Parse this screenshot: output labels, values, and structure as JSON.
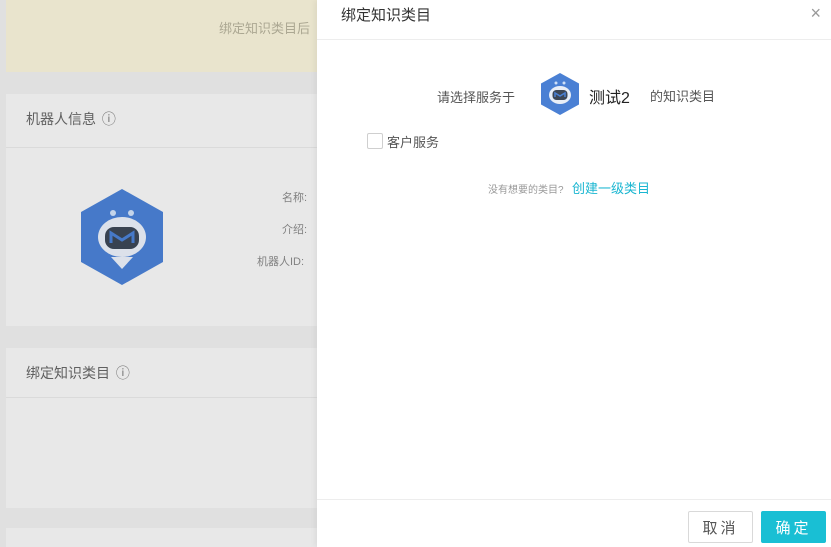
{
  "background": {
    "notice_text": "绑定知识类目后",
    "robot_info": {
      "title": "机器人信息",
      "info_glyph": "ⓘ",
      "labels": [
        "名称:",
        "介绍:",
        "机器人ID:"
      ]
    },
    "bind_section": {
      "title": "绑定知识类目",
      "info_glyph": "ⓘ"
    }
  },
  "drawer": {
    "title": "绑定知识类目",
    "close_glyph": "×",
    "prefix": "请选择服务于",
    "bot_name": "测试2",
    "suffix": "的知识类目",
    "category_option": "客户服务",
    "hint": "没有想要的类目?",
    "create_link": "创建一级类目",
    "cancel_label": "取消",
    "confirm_label": "确定"
  },
  "colors": {
    "accent": "#19bfd4",
    "link": "#1ab6d1",
    "avatar_blue": "#4a80d4"
  }
}
